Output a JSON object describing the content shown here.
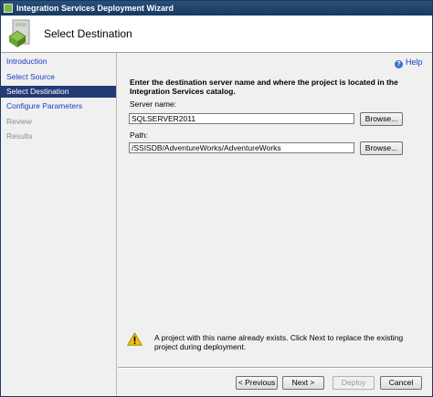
{
  "window": {
    "title": "Integration Services Deployment Wizard"
  },
  "header": {
    "title": "Select Destination"
  },
  "sidebar": {
    "items": [
      {
        "label": "Introduction",
        "state": "link"
      },
      {
        "label": "Select Source",
        "state": "link"
      },
      {
        "label": "Select Destination",
        "state": "selected"
      },
      {
        "label": "Configure Parameters",
        "state": "link"
      },
      {
        "label": "Review",
        "state": "disabled"
      },
      {
        "label": "Results",
        "state": "disabled"
      }
    ]
  },
  "help": {
    "label": "Help",
    "icon": "help-icon"
  },
  "main": {
    "instructions": "Enter the destination server name and where the project is located in the Integration Services catalog.",
    "server": {
      "label": "Server name:",
      "value": "SQLSERVER2011",
      "browse_label": "Browse..."
    },
    "path": {
      "label": "Path:",
      "value": "/SSISDB/AdventureWorks/AdventureWorks",
      "browse_label": "Browse..."
    },
    "warning": {
      "icon": "warning-icon",
      "text": "A project with this name already exists. Click Next to replace the existing project during deployment."
    }
  },
  "footer": {
    "previous_label": "< Previous",
    "next_label": "Next >",
    "deploy_label": "Deploy",
    "cancel_label": "Cancel"
  },
  "colors": {
    "titlebar": "#1f4570",
    "selected_nav": "#233a74",
    "link": "#1a3cc8",
    "warning": "#f2c200"
  }
}
